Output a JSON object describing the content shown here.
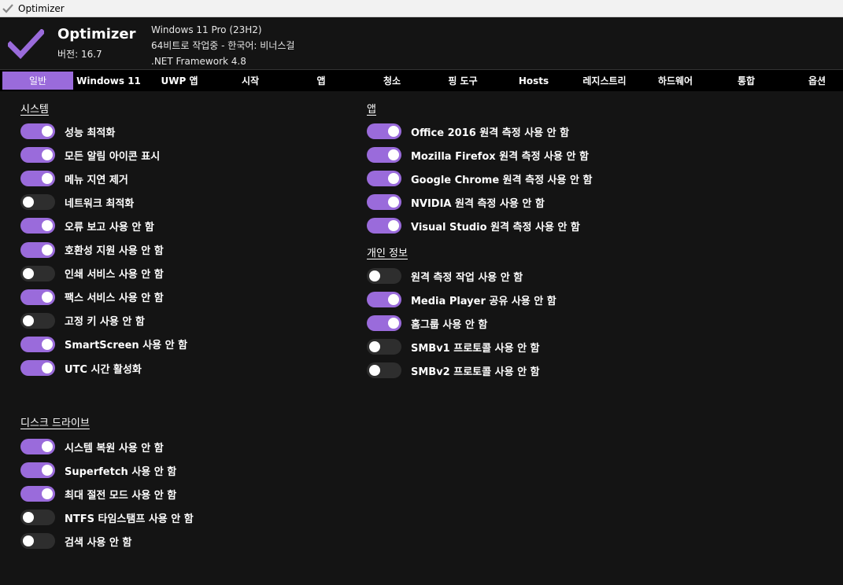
{
  "window": {
    "title": "Optimizer"
  },
  "header": {
    "app_name": "Optimizer",
    "version": "버전: 16.7",
    "os": "Windows 11 Pro (23H2)",
    "arch_lang": "64비트로 작업중 - 한국어: 비너스걸",
    "framework": ".NET Framework 4.8"
  },
  "colors": {
    "accent": "#9a6bdb",
    "background": "#141414",
    "toggle_off": "#2e2e2e"
  },
  "tabs": [
    {
      "label": "일반",
      "active": true
    },
    {
      "label": "Windows 11",
      "active": false
    },
    {
      "label": "UWP 앱",
      "active": false
    },
    {
      "label": "시작",
      "active": false
    },
    {
      "label": "앱",
      "active": false
    },
    {
      "label": "청소",
      "active": false
    },
    {
      "label": "핑 도구",
      "active": false
    },
    {
      "label": "Hosts",
      "active": false
    },
    {
      "label": "레지스트리",
      "active": false
    },
    {
      "label": "하드웨어",
      "active": false
    },
    {
      "label": "통합",
      "active": false
    },
    {
      "label": "옵션",
      "active": false
    }
  ],
  "sections": {
    "system": {
      "title": "시스템",
      "items": [
        {
          "label": "성능 최적화",
          "on": true
        },
        {
          "label": "모든 알림 아이콘 표시",
          "on": true
        },
        {
          "label": "메뉴 지연 제거",
          "on": true
        },
        {
          "label": "네트워크 최적화",
          "on": false
        },
        {
          "label": "오류 보고 사용 안 함",
          "on": true
        },
        {
          "label": "호환성 지원 사용 안 함",
          "on": true
        },
        {
          "label": "인쇄 서비스 사용 안 함",
          "on": false
        },
        {
          "label": "팩스 서비스 사용 안 함",
          "on": true
        },
        {
          "label": "고정 키 사용 안 함",
          "on": false
        },
        {
          "label": "SmartScreen 사용 안 함",
          "on": true
        },
        {
          "label": "UTC 시간 활성화",
          "on": true
        }
      ]
    },
    "disk": {
      "title": "디스크 드라이브",
      "items": [
        {
          "label": "시스템 복원 사용 안 함",
          "on": true
        },
        {
          "label": "Superfetch 사용 안 함",
          "on": true
        },
        {
          "label": "최대 절전 모드 사용 안 함",
          "on": true
        },
        {
          "label": "NTFS 타임스탬프 사용 안 함",
          "on": false
        },
        {
          "label": "검색 사용 안 함",
          "on": false
        }
      ]
    },
    "apps": {
      "title": "앱",
      "items": [
        {
          "label": "Office 2016 원격 측정 사용 안 함",
          "on": true
        },
        {
          "label": "Mozilla Firefox 원격 측정 사용 안 함",
          "on": true
        },
        {
          "label": "Google Chrome 원격 측정 사용 안 함",
          "on": true
        },
        {
          "label": "NVIDIA 원격 측정 사용 안 함",
          "on": true
        },
        {
          "label": "Visual Studio 원격 측정 사용 안 함",
          "on": true
        }
      ]
    },
    "privacy": {
      "title": "개인 정보",
      "items": [
        {
          "label": "원격 측정 작업 사용 안 함",
          "on": false
        },
        {
          "label": "Media Player 공유 사용 안 함",
          "on": true
        },
        {
          "label": "홈그룹 사용 안 함",
          "on": true
        },
        {
          "label": "SMBv1 프로토콜 사용 안 함",
          "on": false
        },
        {
          "label": "SMBv2 프로토콜 사용 안 함",
          "on": false
        }
      ]
    }
  }
}
